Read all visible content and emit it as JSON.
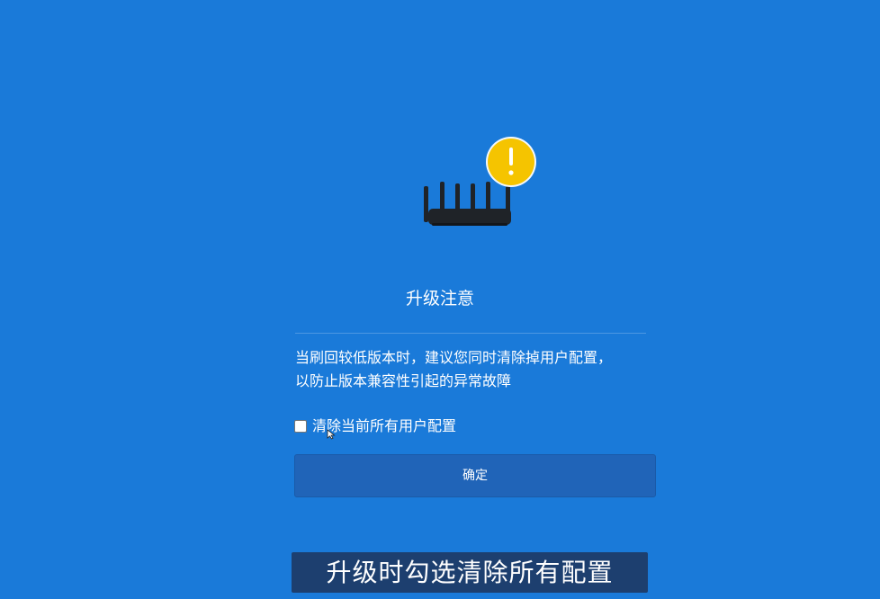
{
  "dialog": {
    "title": "升级注意",
    "message_line1": "当刷回较低版本时，建议您同时清除掉用户配置，",
    "message_line2": "以防止版本兼容性引起的异常故障",
    "checkbox_label": "清除当前所有用户配置",
    "checkbox_checked": false,
    "confirm_label": "确定"
  },
  "caption": {
    "text": "升级时勾选清除所有配置"
  },
  "icons": {
    "router": "router-icon",
    "warning": "warning-icon"
  },
  "colors": {
    "background": "#1a7ad9",
    "button": "#2064b8",
    "warning": "#f5c400",
    "caption_bg": "#1d3f6f"
  }
}
